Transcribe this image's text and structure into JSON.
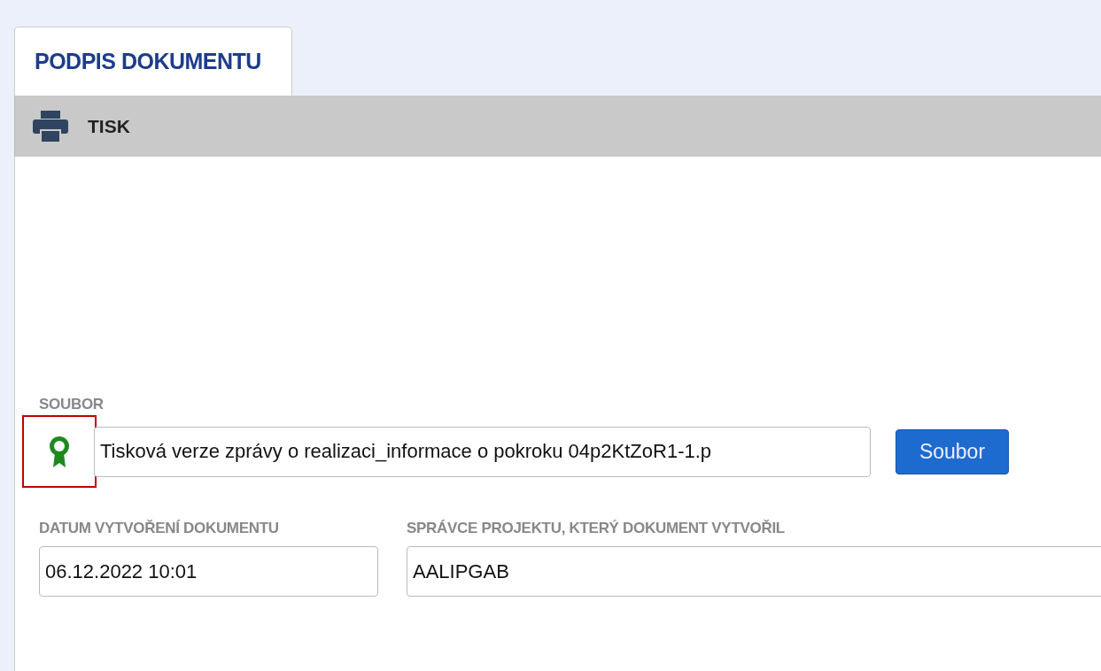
{
  "tabs": [
    {
      "label": "PODPIS DOKUMENTU",
      "selected": true
    }
  ],
  "toolbar": {
    "buttons": [
      {
        "label": "TISK"
      }
    ]
  },
  "file": {
    "label": "SOUBOR",
    "signed": true,
    "highlighted": true,
    "value": "Tisková verze zprávy o realizaci_informace o pokroku 04p2KtZoR1-1.p",
    "button": "Soubor"
  },
  "fields": [
    {
      "label": "DATUM VYTVOŘENÍ DOKUMENTU",
      "value": "06.12.2022 10:01"
    },
    {
      "label": "SPRÁVCE PROJEKTU, KTERÝ DOKUMENT VYTVOŘIL",
      "value": "AALIPGAB"
    }
  ]
}
